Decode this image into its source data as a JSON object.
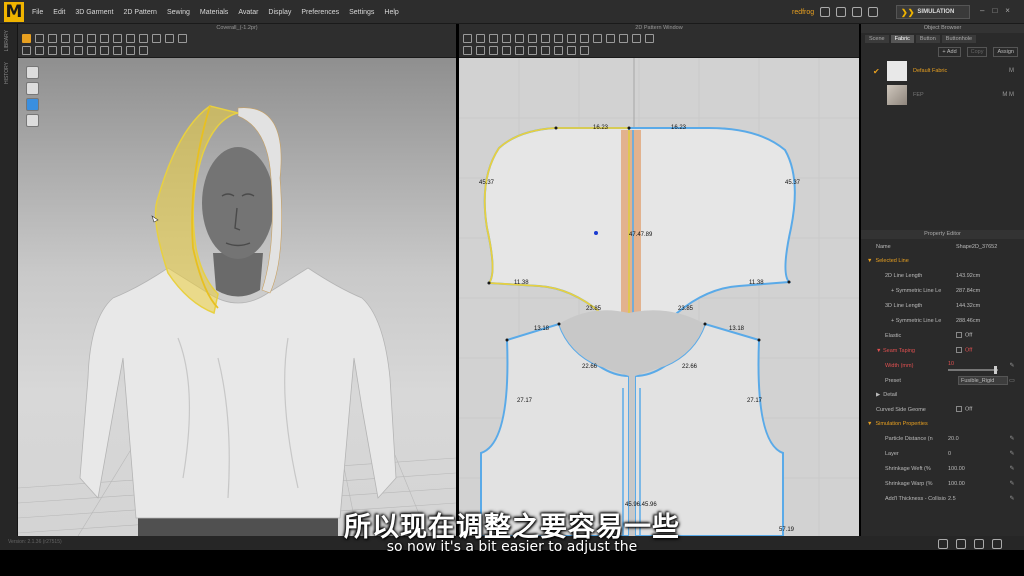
{
  "app": {
    "logo_letter": "M",
    "menu": [
      "File",
      "Edit",
      "3D Garment",
      "2D Pattern",
      "Sewing",
      "Materials",
      "Avatar",
      "Display",
      "Preferences",
      "Settings",
      "Help"
    ],
    "user": "redfrog",
    "simulation_label": "SIMULATION",
    "window_controls": [
      "–",
      "□",
      "×"
    ]
  },
  "left_strip": {
    "tabs": [
      "LIBRARY",
      "HISTORY"
    ]
  },
  "view3d": {
    "title": "Coverall_(-1.2pr)"
  },
  "view2d": {
    "title": "2D Pattern Window",
    "labels": {
      "top_left": "16.23",
      "top_right": "16.23",
      "side_left": "45.37",
      "side_right": "45.37",
      "bottom_left": "11.38",
      "bottom_right": "11.38",
      "neck_left": "23.85",
      "neck_right": "23.85",
      "center": "47.47.89",
      "shoulder_left": "13.18",
      "shoulder_right": "13.18",
      "curve_left": "22.66",
      "curve_right": "22.66",
      "front_left": "27.17",
      "front_right": "27.17",
      "bottom_center": "45.96.45.96",
      "corner_right": "57.19"
    }
  },
  "object_browser": {
    "title": "Object Browser",
    "tabs": [
      "Scene",
      "Fabric",
      "Button",
      "Buttonhole"
    ],
    "active_tab": "Fabric",
    "actions": [
      "+ Add",
      "Copy",
      "Assign"
    ],
    "fabrics": [
      {
        "name": "Default Fabric",
        "meta": "M",
        "active": true
      },
      {
        "name": "FEP",
        "meta": "M M",
        "active": false
      }
    ]
  },
  "property_editor": {
    "title": "Property Editor",
    "name_label": "Name",
    "name_value": "Shape2D_37652",
    "selected_line_label": "Selected Line",
    "line_2d_label": "2D Line Length",
    "line_2d_value": "143.92cm",
    "sym_2d_label": "+ Symmetric Line Le",
    "sym_2d_value": "287.84cm",
    "line_3d_label": "3D Line Length",
    "line_3d_value": "144.32cm",
    "sym_3d_label": "+ Symmetric Line Le",
    "sym_3d_value": "288.46cm",
    "elastic_label": "Elastic",
    "elastic_value": "Off",
    "seam_taping_label": "Seam Taping",
    "seam_taping_value": "Off",
    "width_label": "Width (mm)",
    "width_value": "10",
    "preset_label": "Preset",
    "preset_value": "Fusible_Rigid",
    "detail_label": "Detail",
    "curved_label": "Curved Side Geome",
    "curved_value": "Off",
    "sim_props_label": "Simulation Properties",
    "particle_label": "Particle Distance (n",
    "particle_value": "20.0",
    "layer_label": "Layer",
    "layer_value": "0",
    "weft_label": "Shrinkage Weft (%",
    "weft_value": "100.00",
    "warp_label": "Shrinkage Warp (%",
    "warp_value": "100.00",
    "thickness_label": "Add'l Thickness - Collisio",
    "thickness_value": "2.5"
  },
  "status": {
    "version": "Version: 2.1.36 (r27515)"
  },
  "subtitles": {
    "chinese": "所以现在调整之要容易一些",
    "english": "so now it's a bit easier to adjust the"
  },
  "colors": {
    "accent": "#e8a020",
    "selected_line": "#e8d040",
    "seam_blue": "#5aaae8",
    "warning_red": "#e05050"
  }
}
